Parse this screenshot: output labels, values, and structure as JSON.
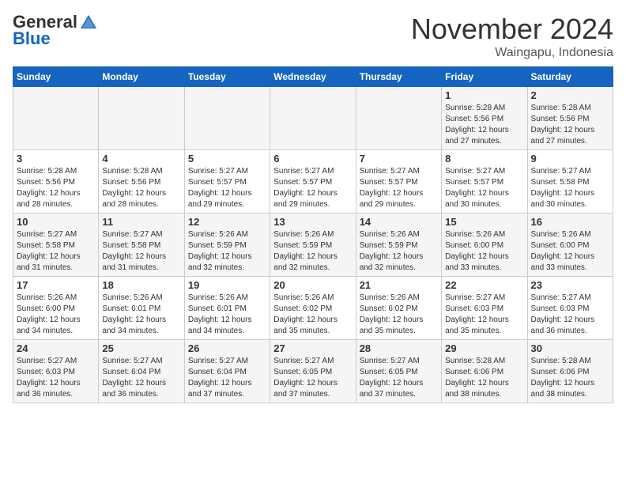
{
  "header": {
    "logo": {
      "general": "General",
      "blue": "Blue",
      "tagline": "GeneralBlue"
    },
    "title": "November 2024",
    "location": "Waingapu, Indonesia"
  },
  "calendar": {
    "days_of_week": [
      "Sunday",
      "Monday",
      "Tuesday",
      "Wednesday",
      "Thursday",
      "Friday",
      "Saturday"
    ],
    "weeks": [
      [
        {
          "day": "",
          "info": ""
        },
        {
          "day": "",
          "info": ""
        },
        {
          "day": "",
          "info": ""
        },
        {
          "day": "",
          "info": ""
        },
        {
          "day": "",
          "info": ""
        },
        {
          "day": "1",
          "info": "Sunrise: 5:28 AM\nSunset: 5:56 PM\nDaylight: 12 hours\nand 27 minutes."
        },
        {
          "day": "2",
          "info": "Sunrise: 5:28 AM\nSunset: 5:56 PM\nDaylight: 12 hours\nand 27 minutes."
        }
      ],
      [
        {
          "day": "3",
          "info": "Sunrise: 5:28 AM\nSunset: 5:56 PM\nDaylight: 12 hours\nand 28 minutes."
        },
        {
          "day": "4",
          "info": "Sunrise: 5:28 AM\nSunset: 5:56 PM\nDaylight: 12 hours\nand 28 minutes."
        },
        {
          "day": "5",
          "info": "Sunrise: 5:27 AM\nSunset: 5:57 PM\nDaylight: 12 hours\nand 29 minutes."
        },
        {
          "day": "6",
          "info": "Sunrise: 5:27 AM\nSunset: 5:57 PM\nDaylight: 12 hours\nand 29 minutes."
        },
        {
          "day": "7",
          "info": "Sunrise: 5:27 AM\nSunset: 5:57 PM\nDaylight: 12 hours\nand 29 minutes."
        },
        {
          "day": "8",
          "info": "Sunrise: 5:27 AM\nSunset: 5:57 PM\nDaylight: 12 hours\nand 30 minutes."
        },
        {
          "day": "9",
          "info": "Sunrise: 5:27 AM\nSunset: 5:58 PM\nDaylight: 12 hours\nand 30 minutes."
        }
      ],
      [
        {
          "day": "10",
          "info": "Sunrise: 5:27 AM\nSunset: 5:58 PM\nDaylight: 12 hours\nand 31 minutes."
        },
        {
          "day": "11",
          "info": "Sunrise: 5:27 AM\nSunset: 5:58 PM\nDaylight: 12 hours\nand 31 minutes."
        },
        {
          "day": "12",
          "info": "Sunrise: 5:26 AM\nSunset: 5:59 PM\nDaylight: 12 hours\nand 32 minutes."
        },
        {
          "day": "13",
          "info": "Sunrise: 5:26 AM\nSunset: 5:59 PM\nDaylight: 12 hours\nand 32 minutes."
        },
        {
          "day": "14",
          "info": "Sunrise: 5:26 AM\nSunset: 5:59 PM\nDaylight: 12 hours\nand 32 minutes."
        },
        {
          "day": "15",
          "info": "Sunrise: 5:26 AM\nSunset: 6:00 PM\nDaylight: 12 hours\nand 33 minutes."
        },
        {
          "day": "16",
          "info": "Sunrise: 5:26 AM\nSunset: 6:00 PM\nDaylight: 12 hours\nand 33 minutes."
        }
      ],
      [
        {
          "day": "17",
          "info": "Sunrise: 5:26 AM\nSunset: 6:00 PM\nDaylight: 12 hours\nand 34 minutes."
        },
        {
          "day": "18",
          "info": "Sunrise: 5:26 AM\nSunset: 6:01 PM\nDaylight: 12 hours\nand 34 minutes."
        },
        {
          "day": "19",
          "info": "Sunrise: 5:26 AM\nSunset: 6:01 PM\nDaylight: 12 hours\nand 34 minutes."
        },
        {
          "day": "20",
          "info": "Sunrise: 5:26 AM\nSunset: 6:02 PM\nDaylight: 12 hours\nand 35 minutes."
        },
        {
          "day": "21",
          "info": "Sunrise: 5:26 AM\nSunset: 6:02 PM\nDaylight: 12 hours\nand 35 minutes."
        },
        {
          "day": "22",
          "info": "Sunrise: 5:27 AM\nSunset: 6:03 PM\nDaylight: 12 hours\nand 35 minutes."
        },
        {
          "day": "23",
          "info": "Sunrise: 5:27 AM\nSunset: 6:03 PM\nDaylight: 12 hours\nand 36 minutes."
        }
      ],
      [
        {
          "day": "24",
          "info": "Sunrise: 5:27 AM\nSunset: 6:03 PM\nDaylight: 12 hours\nand 36 minutes."
        },
        {
          "day": "25",
          "info": "Sunrise: 5:27 AM\nSunset: 6:04 PM\nDaylight: 12 hours\nand 36 minutes."
        },
        {
          "day": "26",
          "info": "Sunrise: 5:27 AM\nSunset: 6:04 PM\nDaylight: 12 hours\nand 37 minutes."
        },
        {
          "day": "27",
          "info": "Sunrise: 5:27 AM\nSunset: 6:05 PM\nDaylight: 12 hours\nand 37 minutes."
        },
        {
          "day": "28",
          "info": "Sunrise: 5:27 AM\nSunset: 6:05 PM\nDaylight: 12 hours\nand 37 minutes."
        },
        {
          "day": "29",
          "info": "Sunrise: 5:28 AM\nSunset: 6:06 PM\nDaylight: 12 hours\nand 38 minutes."
        },
        {
          "day": "30",
          "info": "Sunrise: 5:28 AM\nSunset: 6:06 PM\nDaylight: 12 hours\nand 38 minutes."
        }
      ]
    ]
  }
}
